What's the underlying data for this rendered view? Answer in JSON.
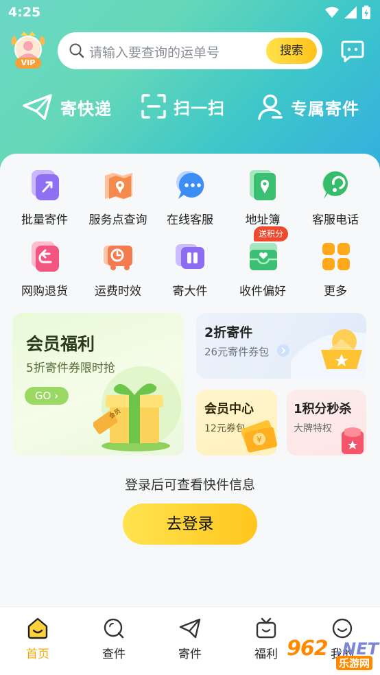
{
  "status_bar": {
    "time": "4:25"
  },
  "header": {
    "vip_badge": "VIP",
    "search_placeholder": "请输入要查询的运单号",
    "search_button": "搜索"
  },
  "quick_actions": [
    {
      "label": "寄快递",
      "icon": "paper-plane-icon"
    },
    {
      "label": "扫一扫",
      "icon": "scan-icon"
    },
    {
      "label": "专属寄件",
      "icon": "user-icon"
    }
  ],
  "grid": [
    {
      "label": "批量寄件",
      "icon": "batch-send-icon",
      "color": "#8f6ff2"
    },
    {
      "label": "服务点查询",
      "icon": "service-point-icon",
      "color": "#f58a4d"
    },
    {
      "label": "在线客服",
      "icon": "chat-bubble-icon",
      "color": "#3d8ef4"
    },
    {
      "label": "地址簿",
      "icon": "address-book-icon",
      "color": "#3bbf72"
    },
    {
      "label": "客服电话",
      "icon": "phone-headset-icon",
      "color": "#36bd6a"
    },
    {
      "label": "网购退货",
      "icon": "return-icon",
      "color": "#f25680"
    },
    {
      "label": "运费时效",
      "icon": "truck-clock-icon",
      "color": "#f27b4f"
    },
    {
      "label": "寄大件",
      "icon": "large-box-icon",
      "color": "#8c6df2"
    },
    {
      "label": "收件偏好",
      "icon": "inbox-heart-icon",
      "color": "#3bbf72"
    },
    {
      "label": "更多",
      "icon": "more-grid-icon",
      "color": "#ffa81c"
    }
  ],
  "points_tag": "送积分",
  "promos": {
    "member": {
      "title": "会员福利",
      "subtitle": "5折寄件券限时抢",
      "go": "GO",
      "tag": "会员"
    },
    "discount": {
      "title": "2折寄件",
      "subtitle": "26元寄件券包"
    },
    "center": {
      "title": "会员中心",
      "subtitle": "12元券包"
    },
    "flash": {
      "title": "1积分秒杀",
      "subtitle": "大牌特权"
    }
  },
  "login": {
    "hint": "登录后可查看快件信息",
    "button": "去登录"
  },
  "tabs": [
    {
      "label": "首页",
      "active": true
    },
    {
      "label": "查件",
      "active": false
    },
    {
      "label": "寄件",
      "active": false
    },
    {
      "label": "福利",
      "active": false
    },
    {
      "label": "我的",
      "active": false
    }
  ],
  "watermark": {
    "number": "962",
    "dot": ".NET",
    "site": "乐游网"
  },
  "colors": {
    "accent": "#ffc61d",
    "active_tab": "#f5a800",
    "top_gradient": "#3ec7c9"
  }
}
